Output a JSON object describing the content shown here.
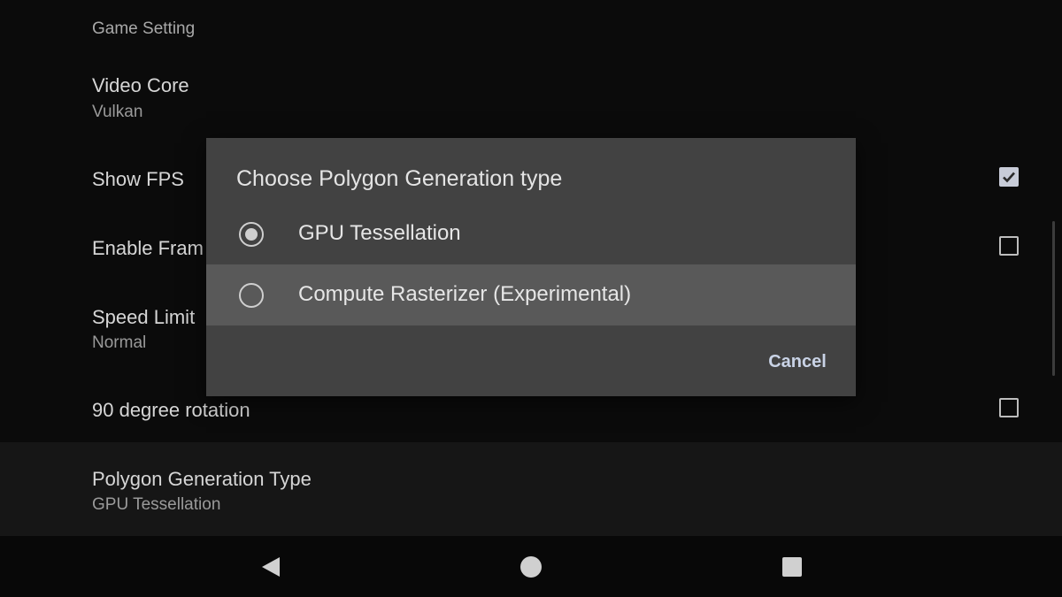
{
  "settings": {
    "section_header": "Game Setting",
    "video_core": {
      "title": "Video Core",
      "summary": "Vulkan"
    },
    "show_fps": {
      "title": "Show FPS",
      "checked": true
    },
    "enable_frame": {
      "title": "Enable Fram",
      "checked": false
    },
    "speed_limit": {
      "title": "Speed Limit",
      "summary": "Normal"
    },
    "rotation": {
      "title": "90 degree rotation",
      "checked": false
    },
    "polygon_type": {
      "title": "Polygon Generation Type",
      "summary": "GPU Tessellation"
    }
  },
  "dialog": {
    "title": "Choose Polygon Generation type",
    "options": [
      {
        "label": "GPU Tessellation",
        "selected": true
      },
      {
        "label": "Compute Rasterizer (Experimental)",
        "selected": false
      }
    ],
    "cancel_label": "Cancel"
  },
  "navbar": {
    "icons": [
      "back-icon",
      "home-icon",
      "recents-icon"
    ]
  },
  "colors": {
    "background": "#0b0b0b",
    "dialog": "#424242",
    "dialog_focused_row": "#595959",
    "accent_text": "#c9d3e6"
  }
}
